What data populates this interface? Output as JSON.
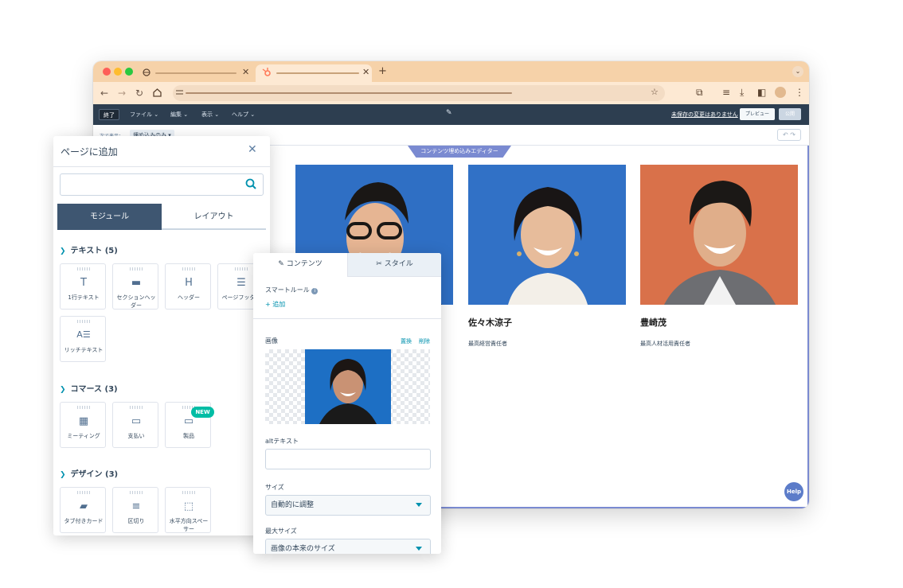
{
  "toolbar": {
    "close_label": "終了",
    "menus": [
      "ファイル",
      "編集",
      "表示",
      "ヘルプ"
    ],
    "unsaved": "未保存の変更はありません",
    "preview": "プレビュー",
    "publish": "公開"
  },
  "subbar": {
    "prefix": "次で表示：",
    "mode": "埋め込みのみ"
  },
  "canvas": {
    "editor_tag": "コンテンツ埋め込みエディター",
    "help": "Help"
  },
  "people": [
    {
      "name": "佐々木涼子",
      "role": "最高経営責任者"
    },
    {
      "name": "豊崎茂",
      "role": "最高人材活用責任者"
    }
  ],
  "add_panel": {
    "title": "ページに追加",
    "search_placeholder": "",
    "tabs": [
      "モジュール",
      "レイアウト"
    ],
    "categories": [
      {
        "label": "テキスト (5)",
        "items": [
          "1行テキスト",
          "セクションヘッダー",
          "ヘッダー",
          "ページフッター",
          "リッチテキスト"
        ]
      },
      {
        "label": "コマース (3)",
        "items": [
          "ミーティング",
          "支払い",
          "製品"
        ],
        "badge": "NEW"
      },
      {
        "label": "デザイン (3)",
        "items": [
          "タブ付きカード",
          "区切り",
          "水平方向スペーサー"
        ]
      }
    ]
  },
  "inspector": {
    "tabs": [
      "コンテンツ",
      "スタイル"
    ],
    "smart_rules": "スマートルール",
    "add": "追加",
    "image_label": "画像",
    "replace": "置換",
    "delete": "削除",
    "alt_label": "altテキスト",
    "alt_value": "",
    "size_label": "サイズ",
    "size_value": "自動的に調整",
    "max_size_label": "最大サイズ",
    "max_size_value": "画像の本来のサイズ"
  },
  "colors": {
    "accent": "#0091ae",
    "dark": "#2d3e50",
    "tab_active": "#3e5671",
    "tag": "#7a8ad1",
    "badge": "#00bda5",
    "browser_tab": "#f6d2a9"
  }
}
